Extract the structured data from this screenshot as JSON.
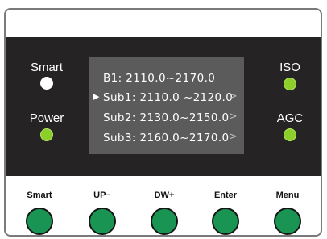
{
  "indicators": {
    "smart": {
      "label": "Smart",
      "color": "#ffffff"
    },
    "power": {
      "label": "Power",
      "color": "#8ccf2a"
    },
    "iso": {
      "label": "ISO",
      "color": "#8ccf2a"
    },
    "agc": {
      "label": "AGC",
      "color": "#8ccf2a"
    }
  },
  "display": {
    "rows": [
      {
        "text": "B1: 2110.0~2170.0",
        "selected": false,
        "arrow": ""
      },
      {
        "text": "Sub1: 2110.0 ~2120.0",
        "selected": true,
        "arrow": ">"
      },
      {
        "text": "Sub2: 2130.0~2150.0",
        "selected": false,
        "arrow": ">"
      },
      {
        "text": "Sub3: 2160.0~2170.0",
        "selected": false,
        "arrow": ">"
      }
    ],
    "cursor_glyph": "▶"
  },
  "buttons": [
    {
      "label": "Smart"
    },
    {
      "label": "UP−"
    },
    {
      "label": "DW+"
    },
    {
      "label": "Enter"
    },
    {
      "label": "Menu"
    }
  ],
  "colors": {
    "panel": "#252323",
    "screen": "#5b5b5b",
    "button": "#1a9452",
    "led_green": "#8ccf2a"
  }
}
